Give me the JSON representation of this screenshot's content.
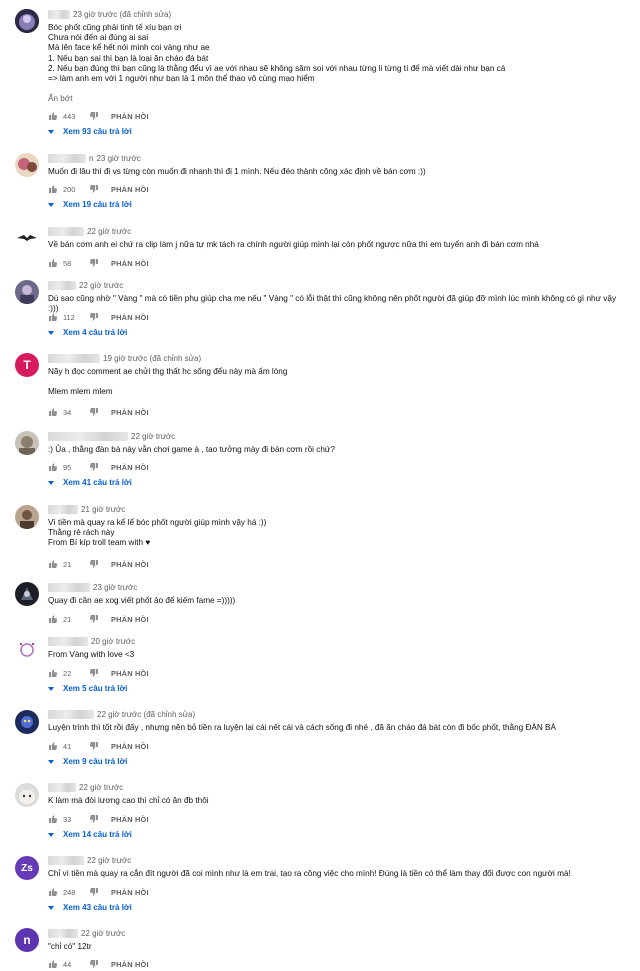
{
  "labels": {
    "reply": "PHẢN HỒI"
  },
  "icons": {
    "like": "thumb-up-icon",
    "dislike": "thumb-down-icon",
    "expand": "chevron-down-icon"
  },
  "colors": {
    "reply_link": "#065fd4",
    "meta": "#606060",
    "avatar_T": "#d81b60",
    "avatar_Zs": "#673ab7",
    "avatar_n": "#5e35b1"
  },
  "comments": [
    {
      "time": "23 giờ trước (đã chỉnh sửa)",
      "text": "Bóc phốt cũng phải tinh tế xíu bạn ơi\nChưa nói đến ai đúng ai sai\nMà lên face kể hết nói mình coi vàng như ae\n1. Nếu bạn sai thì bạn là loại ăn cháo đá bát\n2. Nếu bạn đúng thì bạn cũng là thằng đểu vì ae với nhau sẽ không săm soi với nhau từng li từng tí để mà viết dài như bạn cả\n=> làm anh em với 1 người như bạn là 1 môn thể thao vô cùng mạo hiểm",
      "show_less": "Ẩn bớt",
      "likes": "443",
      "replies": "Xem 93 câu trả lời"
    },
    {
      "name_suffix": "n",
      "time": "23 giờ trước",
      "text": "Muốn đi lâu thì đi vs từng còn muốn đi nhanh thì đi 1 mình. Nếu đéo thành công xác định về bán cơm :))",
      "likes": "200",
      "replies": "Xem 19 câu trả lời"
    },
    {
      "time": "22 giờ trước",
      "text": "Về bán cơm anh ei chứ ra clip làm j nữa tự mk tách ra chính người giúp mình lại còn phốt ngược nữa thì em tuyển anh đi bán cơm nhá",
      "likes": "58"
    },
    {
      "time": "22 giờ trước",
      "text": "Dù sao cũng nhờ \" Vàng \" mà có tiền phụ giúp cha mẹ nếu \" Vàng \" có lỗi thật thì cũng không nên phốt người đã giúp đỡ mình lúc mình không có gì như vậy :)))",
      "likes": "112",
      "replies": "Xem 4 câu trả lời"
    },
    {
      "avatar_letter": "T",
      "time": "19 giờ trước (đã chỉnh sửa)",
      "text": "Nãy h đọc comment ae chửi thg thất hc sống đểu này mà ấm lòng\n\nMlem mlem mlem",
      "likes": "34"
    },
    {
      "time": "22 giờ trước",
      "text": ":) Ủa , thằng đàn bà này vẫn chơi game à , tao tưởng mày đi bán cơm rồi chứ?",
      "likes": "95",
      "replies": "Xem 41 câu trả lời"
    },
    {
      "time": "21 giờ trước",
      "text": "Vì tiền mà quay ra kể lể bóc phốt người giúp mình vậy há :))\nThằng rẻ rách này\nFrom Bí kíp troll team with ♥",
      "likes": "21"
    },
    {
      "time": "23 giờ trước",
      "text": "Quay đi cần ae xog viết phốt ảo để kiếm fame =)))))",
      "likes": "21"
    },
    {
      "time": "20 giờ trước",
      "text": "From Vàng with love <3",
      "likes": "22",
      "replies": "Xem 5 câu trả lời"
    },
    {
      "time": "22 giờ trước (đã chỉnh sửa)",
      "text": "Luyện trình thì tốt rồi đấy , nhưng nên bỏ tiền ra luyện lại cái nết cái và cách sống đi nhé , đã ăn cháo đá bát còn đi bốc phốt, thằng ĐÀN BÀ",
      "likes": "41",
      "replies": "Xem 9 câu trả lời"
    },
    {
      "time": "22 giờ trước",
      "text": "K làm mà đòi lương cao thì chỉ có ăn đb thôi",
      "likes": "33",
      "replies": "Xem 14 câu trả lời"
    },
    {
      "avatar_letter": "Zs",
      "time": "22 giờ trước",
      "text": "Chỉ vì tiền mà quay ra cắn đít người đã coi mình như là em trai, tạo ra công việc cho mình! Đúng là tiền có thể làm thay đổi được con người mà!",
      "likes": "248",
      "replies": "Xem 43 câu trả lời"
    },
    {
      "avatar_letter": "n",
      "time": "22 giờ trước",
      "text": "\"chỉ có\" 12tr",
      "likes": "44"
    }
  ]
}
